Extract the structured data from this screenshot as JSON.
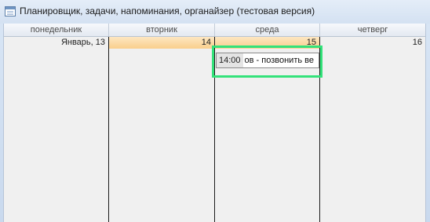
{
  "window": {
    "title": "Планировщик, задачи, напоминания, органайзер (тестовая версия)"
  },
  "calendar": {
    "days": [
      {
        "header": "понедельник",
        "date": "Январь, 13",
        "today": false
      },
      {
        "header": "вторник",
        "date": "14",
        "today": true
      },
      {
        "header": "среда",
        "date": "15",
        "today": false
      },
      {
        "header": "четверг",
        "date": "16",
        "today": false
      }
    ],
    "event": {
      "time": "14:00",
      "text": "ов - позвонить ве"
    }
  },
  "colors": {
    "highlight": "#33e27a",
    "today_header": "#f9cf8c"
  }
}
